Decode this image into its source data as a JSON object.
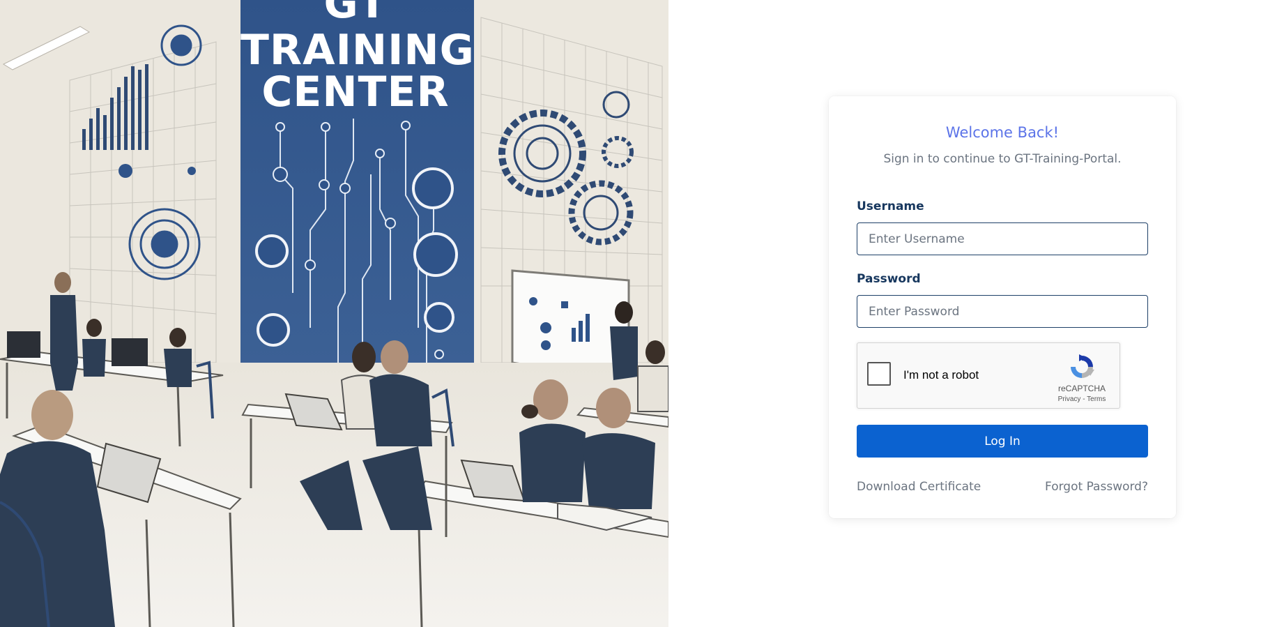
{
  "hero": {
    "title_line1": "GT",
    "title_line2": "TRAINING",
    "title_line3": "CENTER",
    "colors": {
      "banner": "#2f5389",
      "background": "#eeeae2",
      "ink": "#2d3e55"
    }
  },
  "login": {
    "welcome": "Welcome Back!",
    "subtitle": "Sign in to continue to GT-Training-Portal.",
    "username_label": "Username",
    "username_placeholder": "Enter Username",
    "password_label": "Password",
    "password_placeholder": "Enter Password",
    "recaptcha": {
      "label": "I'm not a robot",
      "brand": "reCAPTCHA",
      "privacy": "Privacy",
      "separator": "-",
      "terms": "Terms"
    },
    "login_button": "Log In",
    "download_certificate": "Download Certificate",
    "forgot_password": "Forgot Password?",
    "colors": {
      "accent": "#5b73e8",
      "button": "#0b62d0",
      "label": "#17375e",
      "muted": "#6b7480"
    }
  }
}
